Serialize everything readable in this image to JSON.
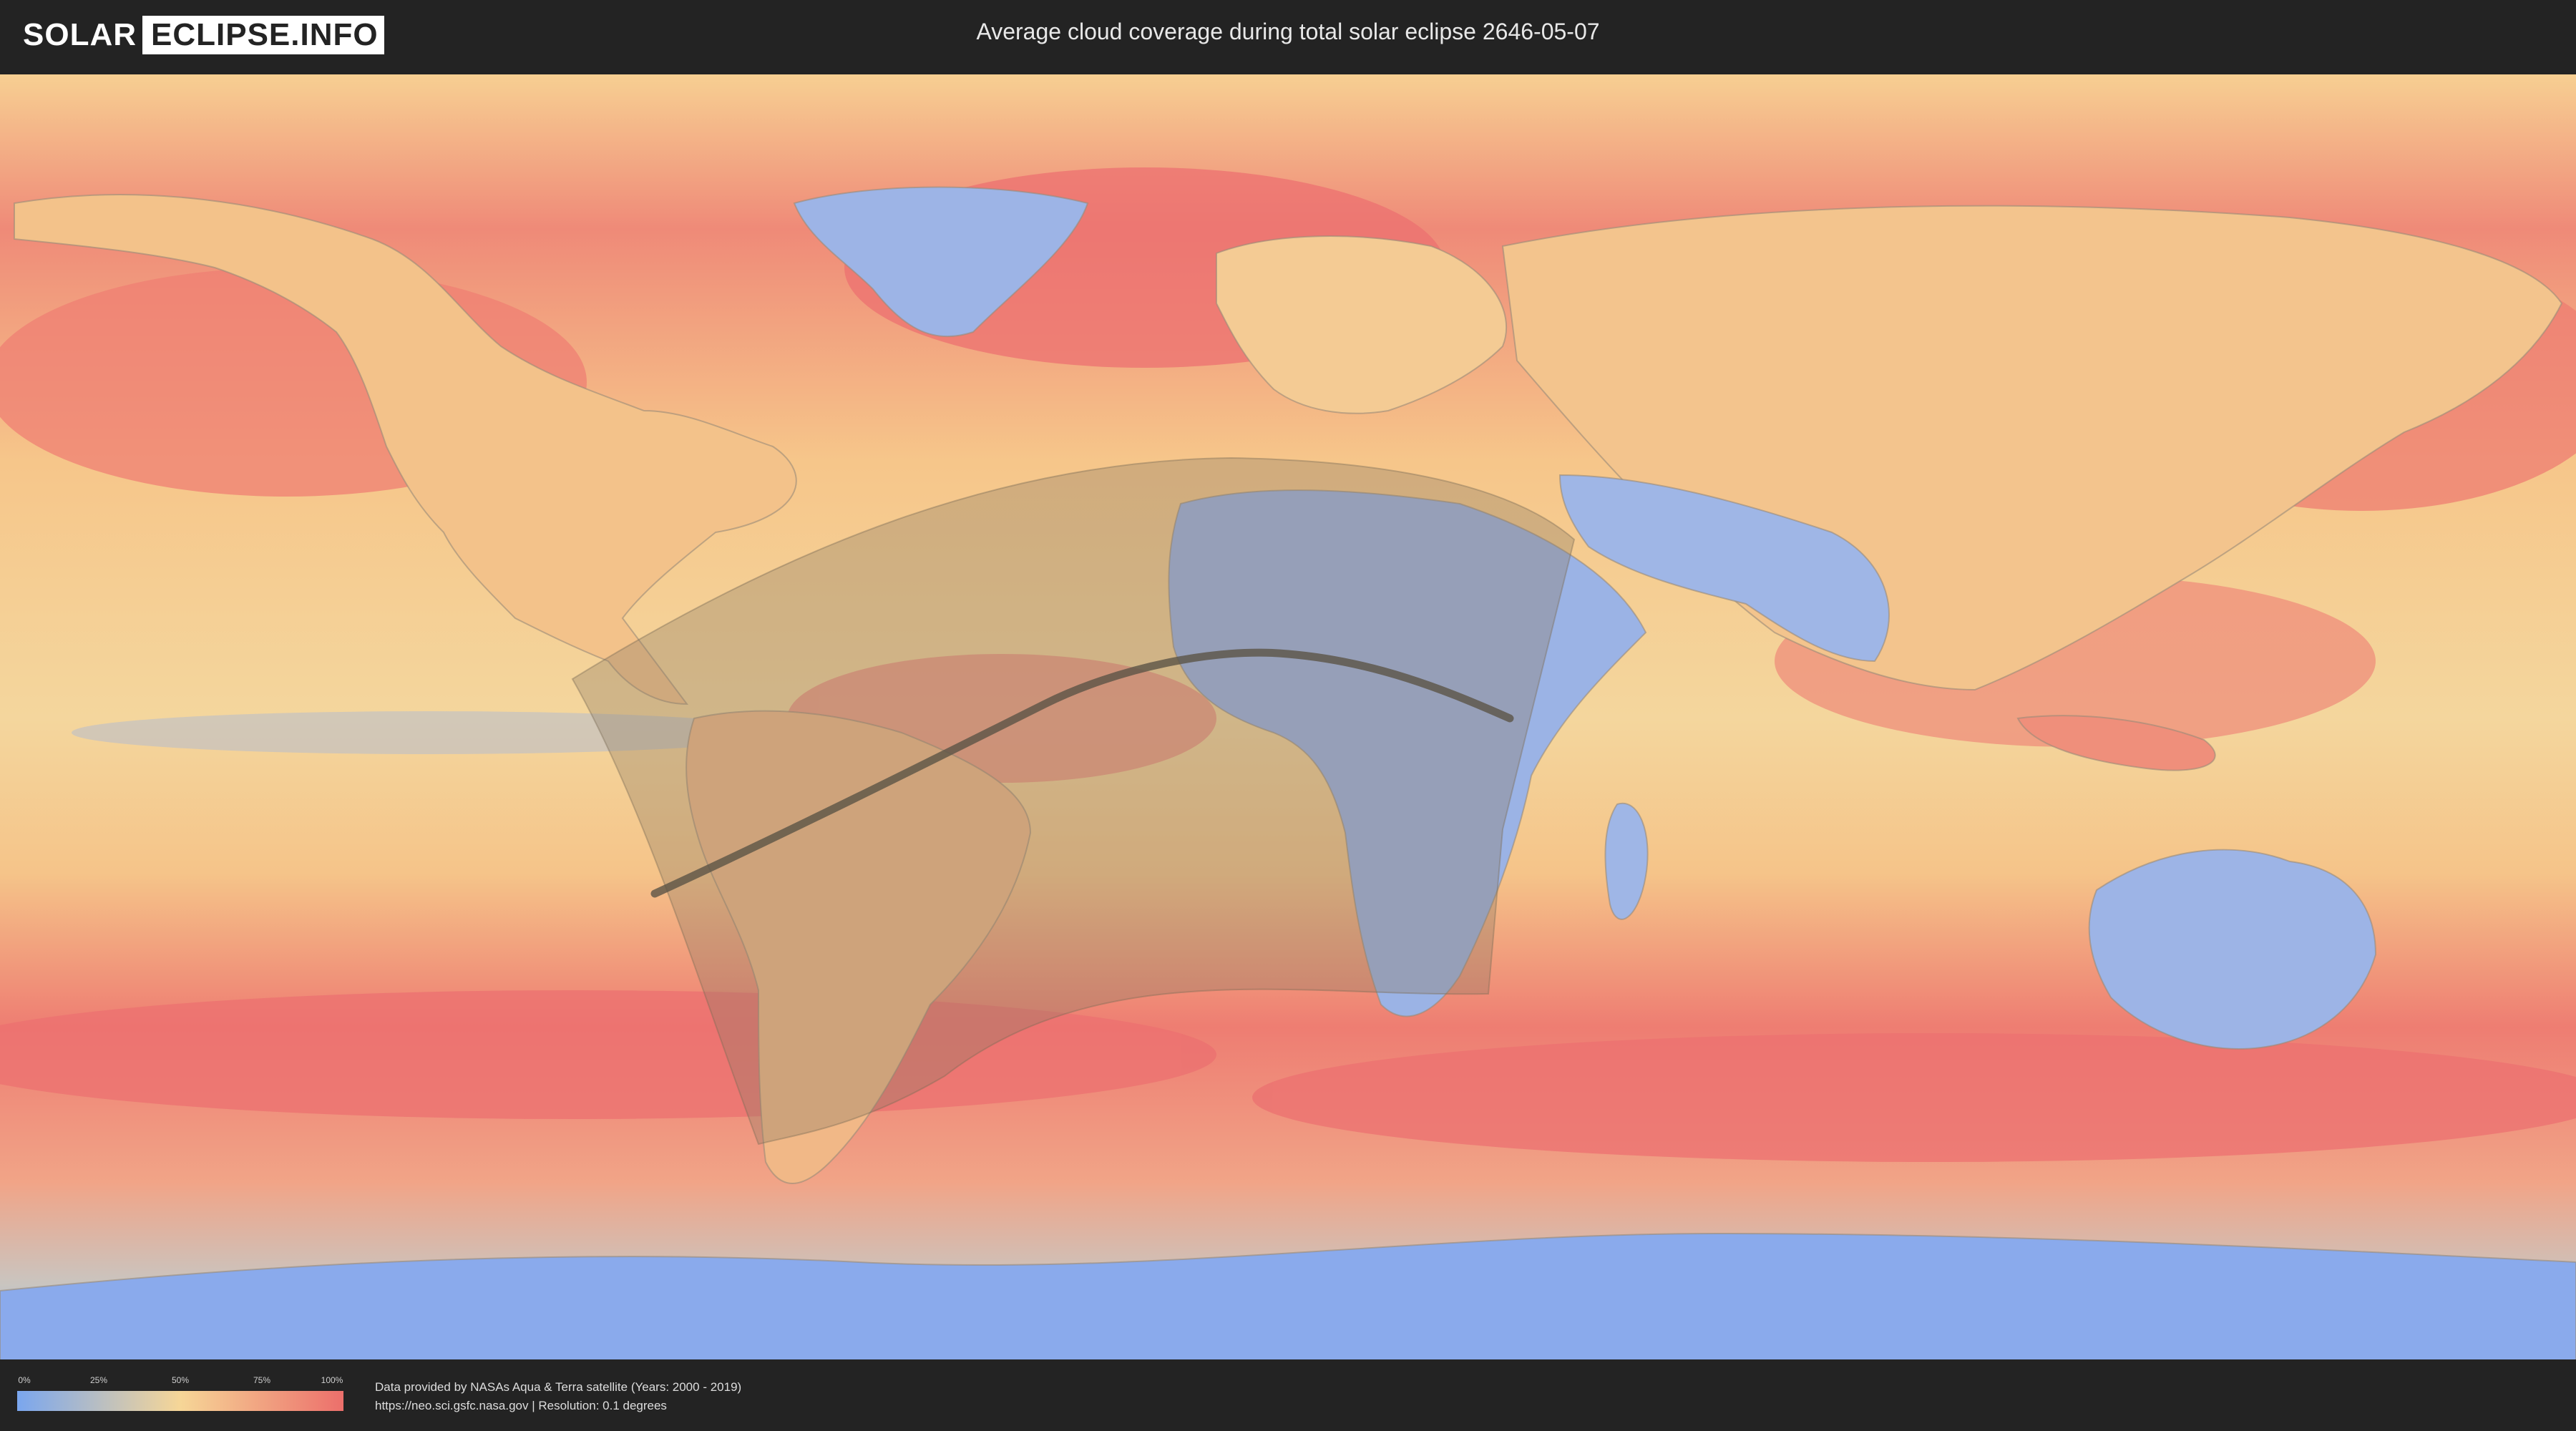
{
  "header": {
    "logo_left": "SOLAR",
    "logo_right": "ECLIPSE.INFO",
    "title": "Average cloud coverage during total solar eclipse 2646-05-07"
  },
  "map": {
    "type": "cloud-coverage world map",
    "projection": "equirectangular",
    "features": [
      "continents",
      "country borders",
      "eclipse visibility zone",
      "path of totality"
    ],
    "colors": {
      "clear": "#7aa6ee",
      "mid": "#f6d697",
      "cloudy": "#ec6f6b",
      "zone_overlay": "#8c7b64",
      "totality_path": "#5b5446"
    }
  },
  "legend": {
    "ticks": [
      "0%",
      "25%",
      "50%",
      "75%",
      "100%"
    ],
    "gradient": [
      "#7aa6ee",
      "#f6d697",
      "#ec6f6b"
    ]
  },
  "footer": {
    "credit_line1": "Data provided by NASAs Aqua & Terra satellite (Years: 2000 - 2019)",
    "credit_line2": "https://neo.sci.gsfc.nasa.gov | Resolution: 0.1 degrees"
  }
}
